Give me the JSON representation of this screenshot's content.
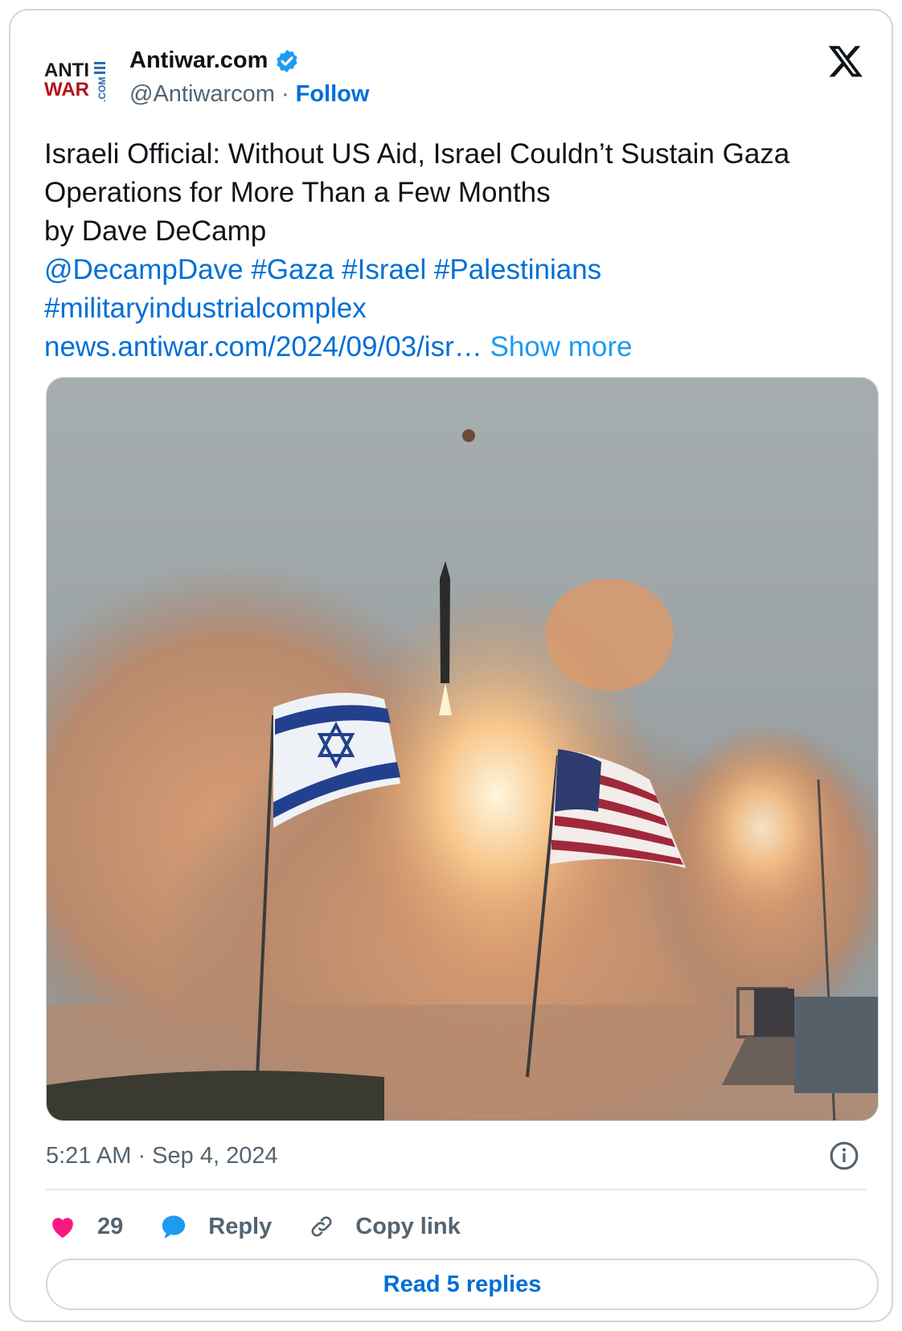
{
  "author": {
    "logo_text_top": "ANTI",
    "logo_text_bottom": "WAR",
    "logo_text_side": ".COM",
    "name": "Antiwar.com",
    "verified": true,
    "handle": "@Antiwarcom",
    "separator": "·",
    "follow_label": "Follow"
  },
  "tweet": {
    "line1": "Israeli Official: Without US Aid, Israel Couldn’t Sustain Gaza",
    "line2": "Operations for More Than a Few Months",
    "line3": "by Dave DeCamp",
    "mention": "@DecampDave",
    "hashtags": [
      "#Gaza",
      "#Israel",
      "#Palestinians",
      "#militaryindustrialcomplex"
    ],
    "link": "news.antiwar.com/2024/09/03/isr…",
    "show_more": "Show more"
  },
  "media": {
    "description_icon": "photo"
  },
  "footer": {
    "timestamp": "5:21 AM · Sep 4, 2024",
    "likes": "29",
    "reply_label": "Reply",
    "copy_link_label": "Copy link",
    "read_replies_label": "Read 5 replies"
  },
  "colors": {
    "link": "#006fd6",
    "show_more": "#1d9bf0",
    "verified": "#1d9bf0",
    "heart": "#f91880",
    "reply_icon": "#1d9bf0",
    "muted": "#536471",
    "logo_red": "#b3121c",
    "logo_blue": "#2a6db0"
  }
}
